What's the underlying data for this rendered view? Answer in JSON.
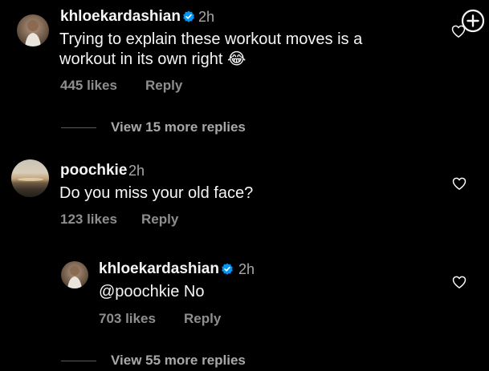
{
  "comments": [
    {
      "username": "khloekardashian",
      "verified": true,
      "time": "2h",
      "text_line1": "Trying to explain these workout moves is a",
      "text_line2": "workout in its own right",
      "emoji": "😂",
      "likes": "445 likes",
      "reply": "Reply",
      "view_more": "View 15 more replies"
    },
    {
      "username": "poochkie",
      "verified": false,
      "time": "2h",
      "text": "Do you miss your old face?",
      "likes": "123 likes",
      "reply": "Reply",
      "replies": [
        {
          "username": "khloekardashian",
          "verified": true,
          "time": "2h",
          "text": "@poochkie No",
          "likes": "703 likes",
          "reply": "Reply"
        }
      ],
      "view_more": "View 55 more replies"
    }
  ],
  "icons": {
    "heart": "heart-outline-icon",
    "verified": "verified-badge-icon",
    "add": "plus-circle-icon"
  },
  "colors": {
    "background": "#000000",
    "primary_text": "#f5f5f5",
    "secondary_text": "#a8a8a8",
    "verified": "#0095f6"
  }
}
